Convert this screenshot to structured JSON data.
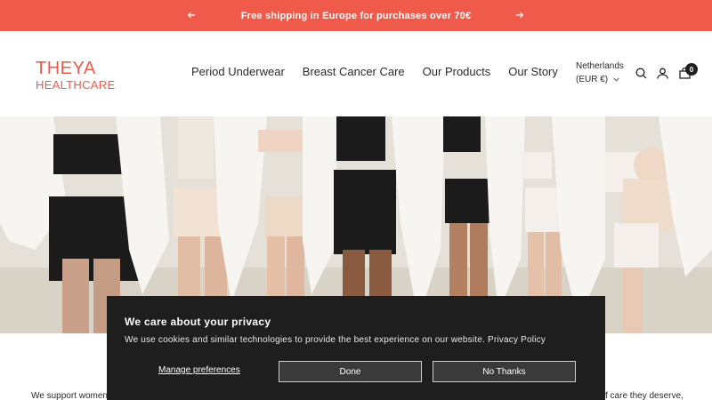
{
  "announcement": {
    "text": "Free shipping in Europe for purchases over 70€",
    "prev_icon": "arrow-left-icon",
    "next_icon": "arrow-right-icon",
    "background": "#f05a4a"
  },
  "header": {
    "logo_line1": "THEYA",
    "logo_line2": "HEALTHCARE",
    "brand_color": "#f05a4a",
    "nav": [
      "Period Underwear",
      "Breast Cancer Care",
      "Our Products",
      "Our Story"
    ],
    "locale_country": "Netherlands",
    "locale_currency": "(EUR €)",
    "cart_count": "0",
    "icons": [
      "search-icon",
      "account-icon",
      "cart-icon"
    ]
  },
  "hero": {
    "background": "#e3ded5"
  },
  "body": {
    "text_left": "We support women's",
    "text_right": "f care they deserve,"
  },
  "cookie_banner": {
    "title": "We care about your privacy",
    "message": "We use cookies and similar technologies to provide the best experience on our website. Privacy Policy",
    "manage_label": "Manage preferences",
    "done_label": "Done",
    "no_thanks_label": "No Thanks",
    "background": "#1e1e1e"
  }
}
